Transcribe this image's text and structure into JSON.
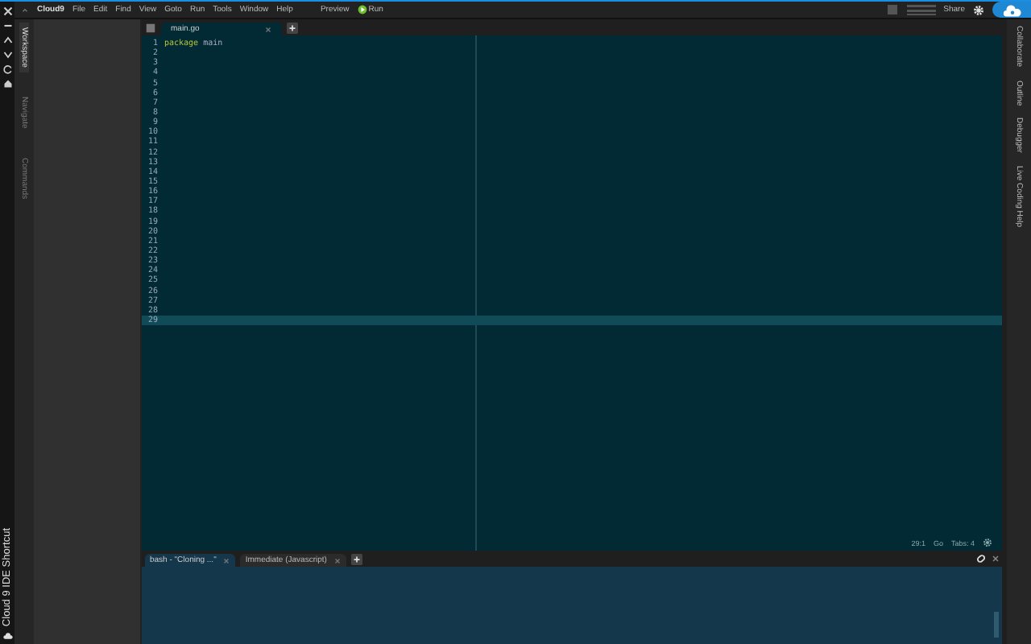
{
  "shortcut_strip": {
    "label": "Cloud 9 IDE Shortcut"
  },
  "menu_bar": {
    "logo": "Cloud9",
    "items": [
      "File",
      "Edit",
      "Find",
      "View",
      "Goto",
      "Run",
      "Tools",
      "Window",
      "Help"
    ],
    "preview": "Preview",
    "run": "Run",
    "share": "Share"
  },
  "left_panel_tabs": [
    {
      "label": "Workspace",
      "selected": true
    },
    {
      "label": "Navigate",
      "selected": false
    },
    {
      "label": "Commands",
      "selected": false
    }
  ],
  "editor": {
    "tabs": [
      {
        "label": "main.go",
        "selected": true
      }
    ],
    "lines": [
      {
        "number": "1",
        "code": "package main",
        "active": false
      },
      {
        "number": "2",
        "active": false
      },
      {
        "number": "3",
        "active": false
      },
      {
        "number": "4",
        "active": false
      },
      {
        "number": "5",
        "active": false
      },
      {
        "number": "6",
        "active": false
      },
      {
        "number": "7",
        "active": false
      },
      {
        "number": "8",
        "active": false
      },
      {
        "number": "9",
        "active": false
      },
      {
        "number": "10",
        "active": false
      },
      {
        "number": "11",
        "active": false
      },
      {
        "number": "12",
        "active": false
      },
      {
        "number": "13",
        "active": false
      },
      {
        "number": "14",
        "active": false
      },
      {
        "number": "15",
        "active": false
      },
      {
        "number": "16",
        "active": false
      },
      {
        "number": "17",
        "active": false
      },
      {
        "number": "18",
        "active": false
      },
      {
        "number": "19",
        "active": false
      },
      {
        "number": "20",
        "active": false
      },
      {
        "number": "21",
        "active": false
      },
      {
        "number": "22",
        "active": false
      },
      {
        "number": "23",
        "active": false
      },
      {
        "number": "24",
        "active": false
      },
      {
        "number": "25",
        "active": false
      },
      {
        "number": "26",
        "active": false
      },
      {
        "number": "27",
        "active": false
      },
      {
        "number": "28",
        "active": false
      },
      {
        "number": "29",
        "active": true
      }
    ],
    "status": {
      "position": "29:1",
      "mode": "Go",
      "tabs": "Tabs: 4"
    }
  },
  "right_panel_tabs": [
    {
      "label": "Collaborate"
    },
    {
      "label": "Outline"
    },
    {
      "label": "Debugger"
    },
    {
      "label": "Live Coding Help"
    }
  ],
  "terminal": {
    "tabs": [
      {
        "label": "bash - \"Cloning ...\"",
        "selected": true
      },
      {
        "label": "Immediate (Javascript)",
        "selected": false
      }
    ]
  }
}
